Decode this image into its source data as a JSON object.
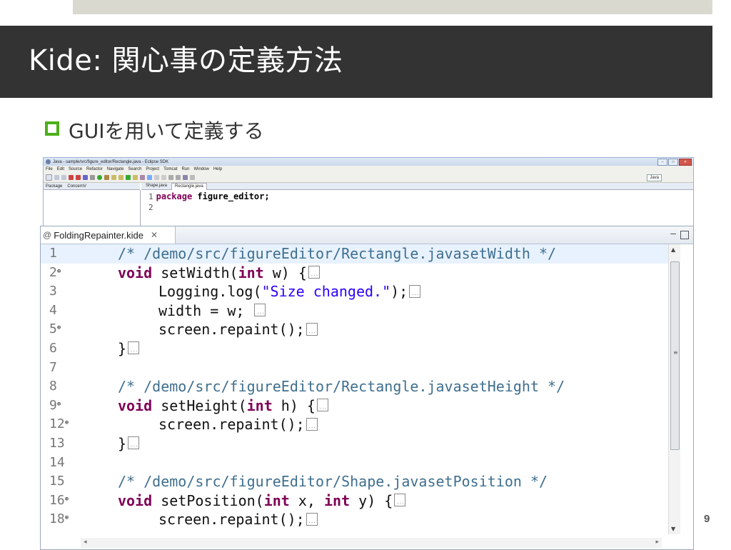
{
  "slide": {
    "title": "Kide: 関心事の定義方法",
    "bullet": "GUIを用いて定義する",
    "page_number": "9"
  },
  "eclipse": {
    "window_title": "Java - sample/src/figure_editor/Rectangle.java - Eclipse SDK",
    "menu": [
      "File",
      "Edit",
      "Source",
      "Refactor",
      "Navigate",
      "Search",
      "Project",
      "Tomcat",
      "Run",
      "Window",
      "Help"
    ],
    "perspective": "Java",
    "left_tabs": [
      "Package",
      "ConcernV"
    ],
    "editor_tabs": [
      "Shape.java",
      "Rectangle.java"
    ],
    "code_lines": [
      {
        "num": "1",
        "kw": "package",
        "rest": " figure_editor;"
      },
      {
        "num": "2",
        "kw": "",
        "rest": ""
      }
    ]
  },
  "kide_editor": {
    "tab_label": "FoldingRepainter.kide",
    "lines": [
      {
        "num": "1",
        "fold": false,
        "current": true,
        "parts": [
          {
            "t": "cm",
            "v": "/* /demo/src/figureEditor/Rectangle.javasetWidth */"
          }
        ]
      },
      {
        "num": "2",
        "fold": true,
        "parts": [
          {
            "t": "kw",
            "v": "void"
          },
          {
            "t": "plain",
            "v": " setWidth("
          },
          {
            "t": "kw",
            "v": "int"
          },
          {
            "t": "plain",
            "v": " w) {"
          }
        ],
        "box": true
      },
      {
        "num": "3",
        "fold": false,
        "indent": true,
        "parts": [
          {
            "t": "plain",
            "v": "Logging.log("
          },
          {
            "t": "str",
            "v": "\"Size changed.\""
          },
          {
            "t": "plain",
            "v": ");"
          }
        ],
        "box": true
      },
      {
        "num": "4",
        "fold": false,
        "indent": true,
        "parts": [
          {
            "t": "plain",
            "v": "width = w; "
          }
        ],
        "box": true
      },
      {
        "num": "5",
        "fold": true,
        "indent": true,
        "parts": [
          {
            "t": "plain",
            "v": "screen.repaint();"
          }
        ],
        "box": true
      },
      {
        "num": "6",
        "fold": false,
        "parts": [
          {
            "t": "plain",
            "v": "}"
          }
        ],
        "box": true
      },
      {
        "num": "7",
        "fold": false,
        "parts": []
      },
      {
        "num": "8",
        "fold": false,
        "parts": [
          {
            "t": "cm",
            "v": "/* /demo/src/figureEditor/Rectangle.javasetHeight */"
          }
        ]
      },
      {
        "num": "9",
        "fold": true,
        "parts": [
          {
            "t": "kw",
            "v": "void"
          },
          {
            "t": "plain",
            "v": " setHeight("
          },
          {
            "t": "kw",
            "v": "int"
          },
          {
            "t": "plain",
            "v": " h) {"
          }
        ],
        "box": true
      },
      {
        "num": "12",
        "fold": true,
        "indent": true,
        "parts": [
          {
            "t": "plain",
            "v": "screen.repaint();"
          }
        ],
        "box": true
      },
      {
        "num": "13",
        "fold": false,
        "parts": [
          {
            "t": "plain",
            "v": "}"
          }
        ],
        "box": true
      },
      {
        "num": "14",
        "fold": false,
        "parts": []
      },
      {
        "num": "15",
        "fold": false,
        "parts": [
          {
            "t": "cm",
            "v": "/* /demo/src/figureEditor/Shape.javasetPosition */"
          }
        ]
      },
      {
        "num": "16",
        "fold": true,
        "parts": [
          {
            "t": "kw",
            "v": "void"
          },
          {
            "t": "plain",
            "v": " setPosition("
          },
          {
            "t": "kw",
            "v": "int"
          },
          {
            "t": "plain",
            "v": " x, "
          },
          {
            "t": "kw",
            "v": "int"
          },
          {
            "t": "plain",
            "v": " y) {"
          }
        ],
        "box": true
      },
      {
        "num": "18",
        "fold": true,
        "indent": true,
        "parts": [
          {
            "t": "plain",
            "v": "screen.repaint();"
          }
        ],
        "box": true
      }
    ]
  },
  "icons": {
    "bullet": "square-bullet-icon",
    "tab": "kide-file-icon",
    "close": "close-icon",
    "fold": "fold-expand-icon"
  },
  "colors": {
    "title_bar": "#333333",
    "bullet": "#4caf1a",
    "keyword": "#7f0055",
    "comment": "#3f6f8f",
    "string": "#2a00ff",
    "current_line": "#e8f2fe"
  }
}
